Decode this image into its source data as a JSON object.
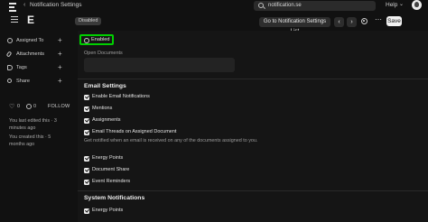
{
  "topbar": {
    "breadcrumb_sep": "‹",
    "breadcrumb": "Notification Settings",
    "search_query": "notification.se",
    "help_label": "Help",
    "help_chevron": "⌄"
  },
  "header": {
    "title": "E",
    "status_badge": "Disabled",
    "goto_label": "Go to Notification Settings List",
    "prev_label": "‹",
    "next_label": "›",
    "more_label": "⋯",
    "save_label": "Save"
  },
  "sidebar": {
    "items": [
      {
        "label": "Assigned To",
        "icon": "user-icon"
      },
      {
        "label": "Attachments",
        "icon": "paperclip-icon"
      },
      {
        "label": "Tags",
        "icon": "tag-icon"
      },
      {
        "label": "Share",
        "icon": "share-icon"
      }
    ],
    "plus": "+",
    "likes": "0",
    "comments": "0",
    "follow_label": "FOLLOW",
    "activity": [
      "You last edited this · 3 minutes ago",
      "You created this · 5 months ago"
    ]
  },
  "form": {
    "enabled_label": "Enabled",
    "open_documents_label": "Open Documents",
    "open_documents_value": "",
    "email_section_title": "Email Settings",
    "email_options": [
      "Enable Email Notifications",
      "Mentions",
      "Assignments",
      "Email Threads on Assigned Document",
      "Energy Points",
      "Document Share",
      "Event Reminders"
    ],
    "email_threads_help": "Get notified when an email is received on any of the documents assigned to you.",
    "system_section_title": "System Notifications",
    "system_options": [
      "Energy Points"
    ]
  },
  "colors": {
    "background": "#111111",
    "highlight_border": "#00d000",
    "save_button": "#f2f2f2"
  }
}
